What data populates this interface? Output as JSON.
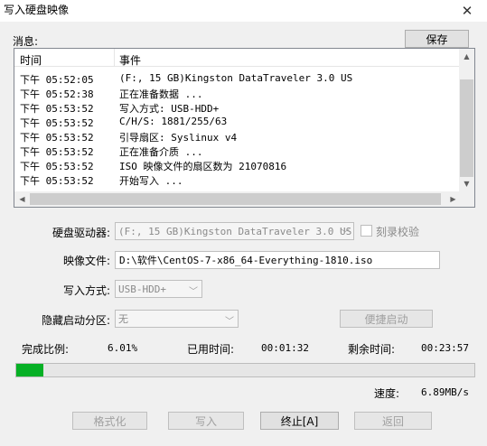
{
  "window": {
    "title": "写入硬盘映像",
    "close_glyph": "✕"
  },
  "messages": {
    "label": "消息:",
    "save_button": "保存",
    "columns": {
      "time": "时间",
      "event": "事件"
    },
    "rows": [
      {
        "time": "下午 05:52:05",
        "event": "(F:, 15 GB)Kingston DataTraveler 3.0 US"
      },
      {
        "time": "下午 05:52:38",
        "event": "正在准备数据 ..."
      },
      {
        "time": "下午 05:53:52",
        "event": "写入方式: USB-HDD+"
      },
      {
        "time": "下午 05:53:52",
        "event": "C/H/S: 1881/255/63"
      },
      {
        "time": "下午 05:53:52",
        "event": "引导扇区: Syslinux v4"
      },
      {
        "time": "下午 05:53:52",
        "event": "正在准备介质 ..."
      },
      {
        "time": "下午 05:53:52",
        "event": "ISO 映像文件的扇区数为 21070816"
      },
      {
        "time": "下午 05:53:52",
        "event": "开始写入 ..."
      }
    ]
  },
  "form": {
    "drive_label": "硬盘驱动器:",
    "drive_value": "(F:, 15 GB)Kingston DataTraveler 3.0 US",
    "verify_label": "刻录校验",
    "image_label": "映像文件:",
    "image_value": "D:\\软件\\CentOS-7-x86_64-Everything-1810.iso",
    "write_mode_label": "写入方式:",
    "write_mode_value": "USB-HDD+",
    "hidden_partition_label": "隐藏启动分区:",
    "hidden_partition_value": "无",
    "quick_boot_button": "便捷启动"
  },
  "progress": {
    "percent_label": "完成比例:",
    "percent_value": "6.01%",
    "percent_fraction": 0.0601,
    "elapsed_label": "已用时间:",
    "elapsed_value": "00:01:32",
    "remaining_label": "剩余时间:",
    "remaining_value": "00:23:57",
    "speed_label": "速度:",
    "speed_value": "6.89MB/s",
    "fill_color": "#06b025"
  },
  "actions": {
    "format": "格式化",
    "write": "写入",
    "abort": "终止[A]",
    "back": "返回"
  }
}
